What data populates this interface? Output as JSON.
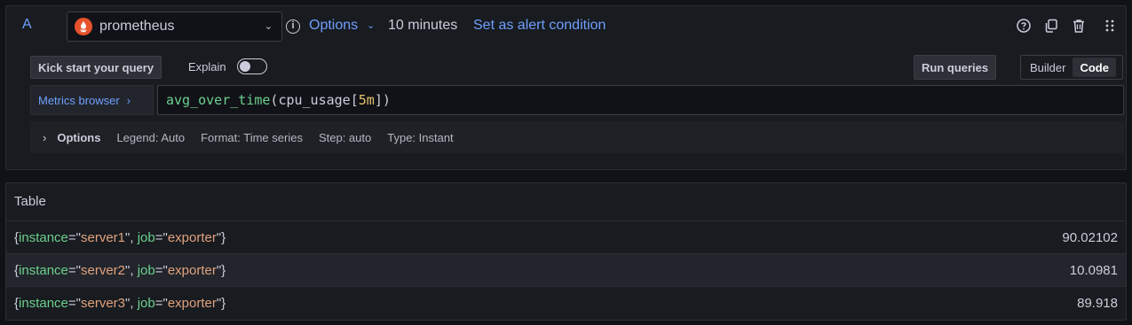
{
  "query": {
    "ref_id": "A",
    "datasource": "prometheus",
    "options_label": "Options",
    "interval": "10 minutes",
    "alert_link": "Set as alert condition"
  },
  "header_icons": [
    "help-icon",
    "duplicate-icon",
    "trash-icon",
    "drag-handle-icon"
  ],
  "toolbar": {
    "kick_start": "Kick start your query",
    "explain": "Explain",
    "explain_enabled": false,
    "run_queries": "Run queries",
    "mode_builder": "Builder",
    "mode_code": "Code",
    "active_mode": "Code"
  },
  "editor": {
    "metrics_browser": "Metrics browser",
    "expr_fn": "avg_over_time",
    "expr_open": "(",
    "expr_metric": "cpu_usage",
    "expr_bracket_open": "[",
    "expr_duration": "5m",
    "expr_bracket_close": "])"
  },
  "options_row": {
    "title": "Options",
    "legend": "Legend: Auto",
    "format": "Format: Time series",
    "step": "Step: auto",
    "type": "Type: Instant"
  },
  "table": {
    "title": "Table",
    "rows": [
      {
        "instance": "server1",
        "job": "exporter",
        "value": "90.02102"
      },
      {
        "instance": "server2",
        "job": "exporter",
        "value": "10.0981"
      },
      {
        "instance": "server3",
        "job": "exporter",
        "value": "89.918"
      }
    ]
  },
  "colors": {
    "accent": "#6e9fff",
    "prometheus": "#e6522c",
    "label_key": "#6ccf8e",
    "label_value": "#e0a27d"
  }
}
